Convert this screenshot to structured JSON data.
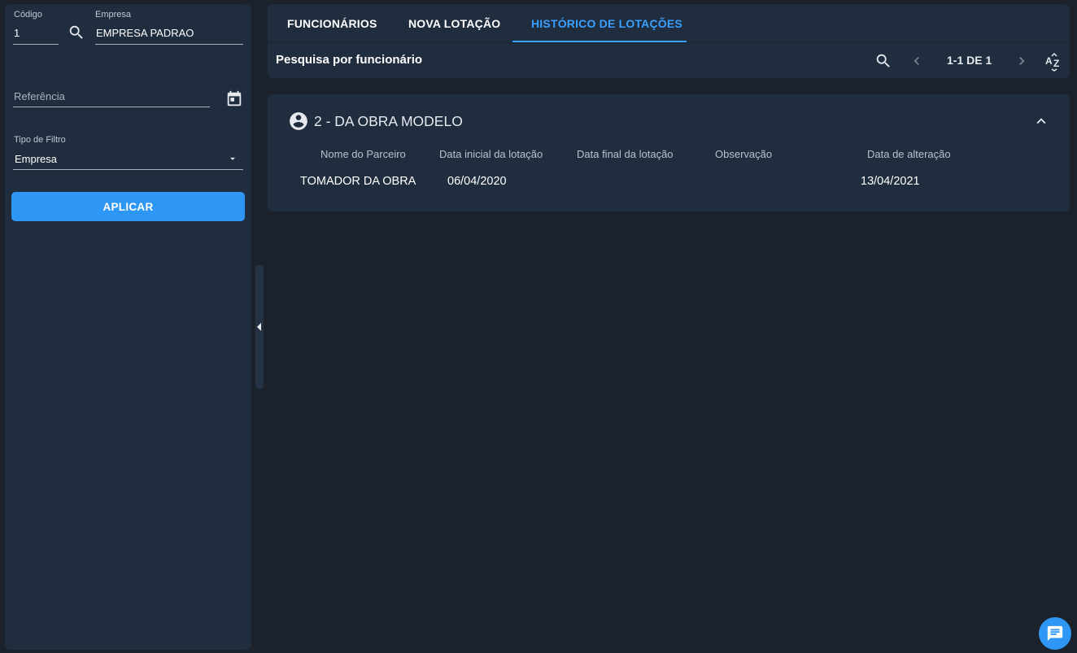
{
  "filters": {
    "codigo": {
      "label": "Código",
      "value": "1"
    },
    "empresa": {
      "label": "Empresa",
      "value": "EMPRESA PADRAO"
    },
    "referencia": {
      "label": "Referência",
      "value": ""
    },
    "tipo_filtro": {
      "label": "Tipo de Filtro",
      "value": "Empresa"
    },
    "apply_label": "APLICAR"
  },
  "tabs": [
    {
      "label": "FUNCIONÁRIOS",
      "active": false
    },
    {
      "label": "NOVA LOTAÇÃO",
      "active": false
    },
    {
      "label": "HISTÓRICO DE LOTAÇÕES",
      "active": true
    }
  ],
  "toolbar": {
    "title": "Pesquisa por funcionário",
    "pager": "1-1 DE 1"
  },
  "record": {
    "title": "2 - DA OBRA MODELO",
    "columns": [
      "Nome do Parceiro",
      "Data inicial da lotação",
      "Data final da lotação",
      "Observação",
      "Data de alteração"
    ],
    "rows": [
      {
        "parceiro": "TOMADOR DA OBRA",
        "data_inicial": "06/04/2020",
        "data_final": "",
        "observacao": "",
        "data_alteracao": "13/04/2021"
      }
    ]
  },
  "colors": {
    "accent": "#2e96f5",
    "background": "#1b222c",
    "panel": "#202d3e"
  }
}
